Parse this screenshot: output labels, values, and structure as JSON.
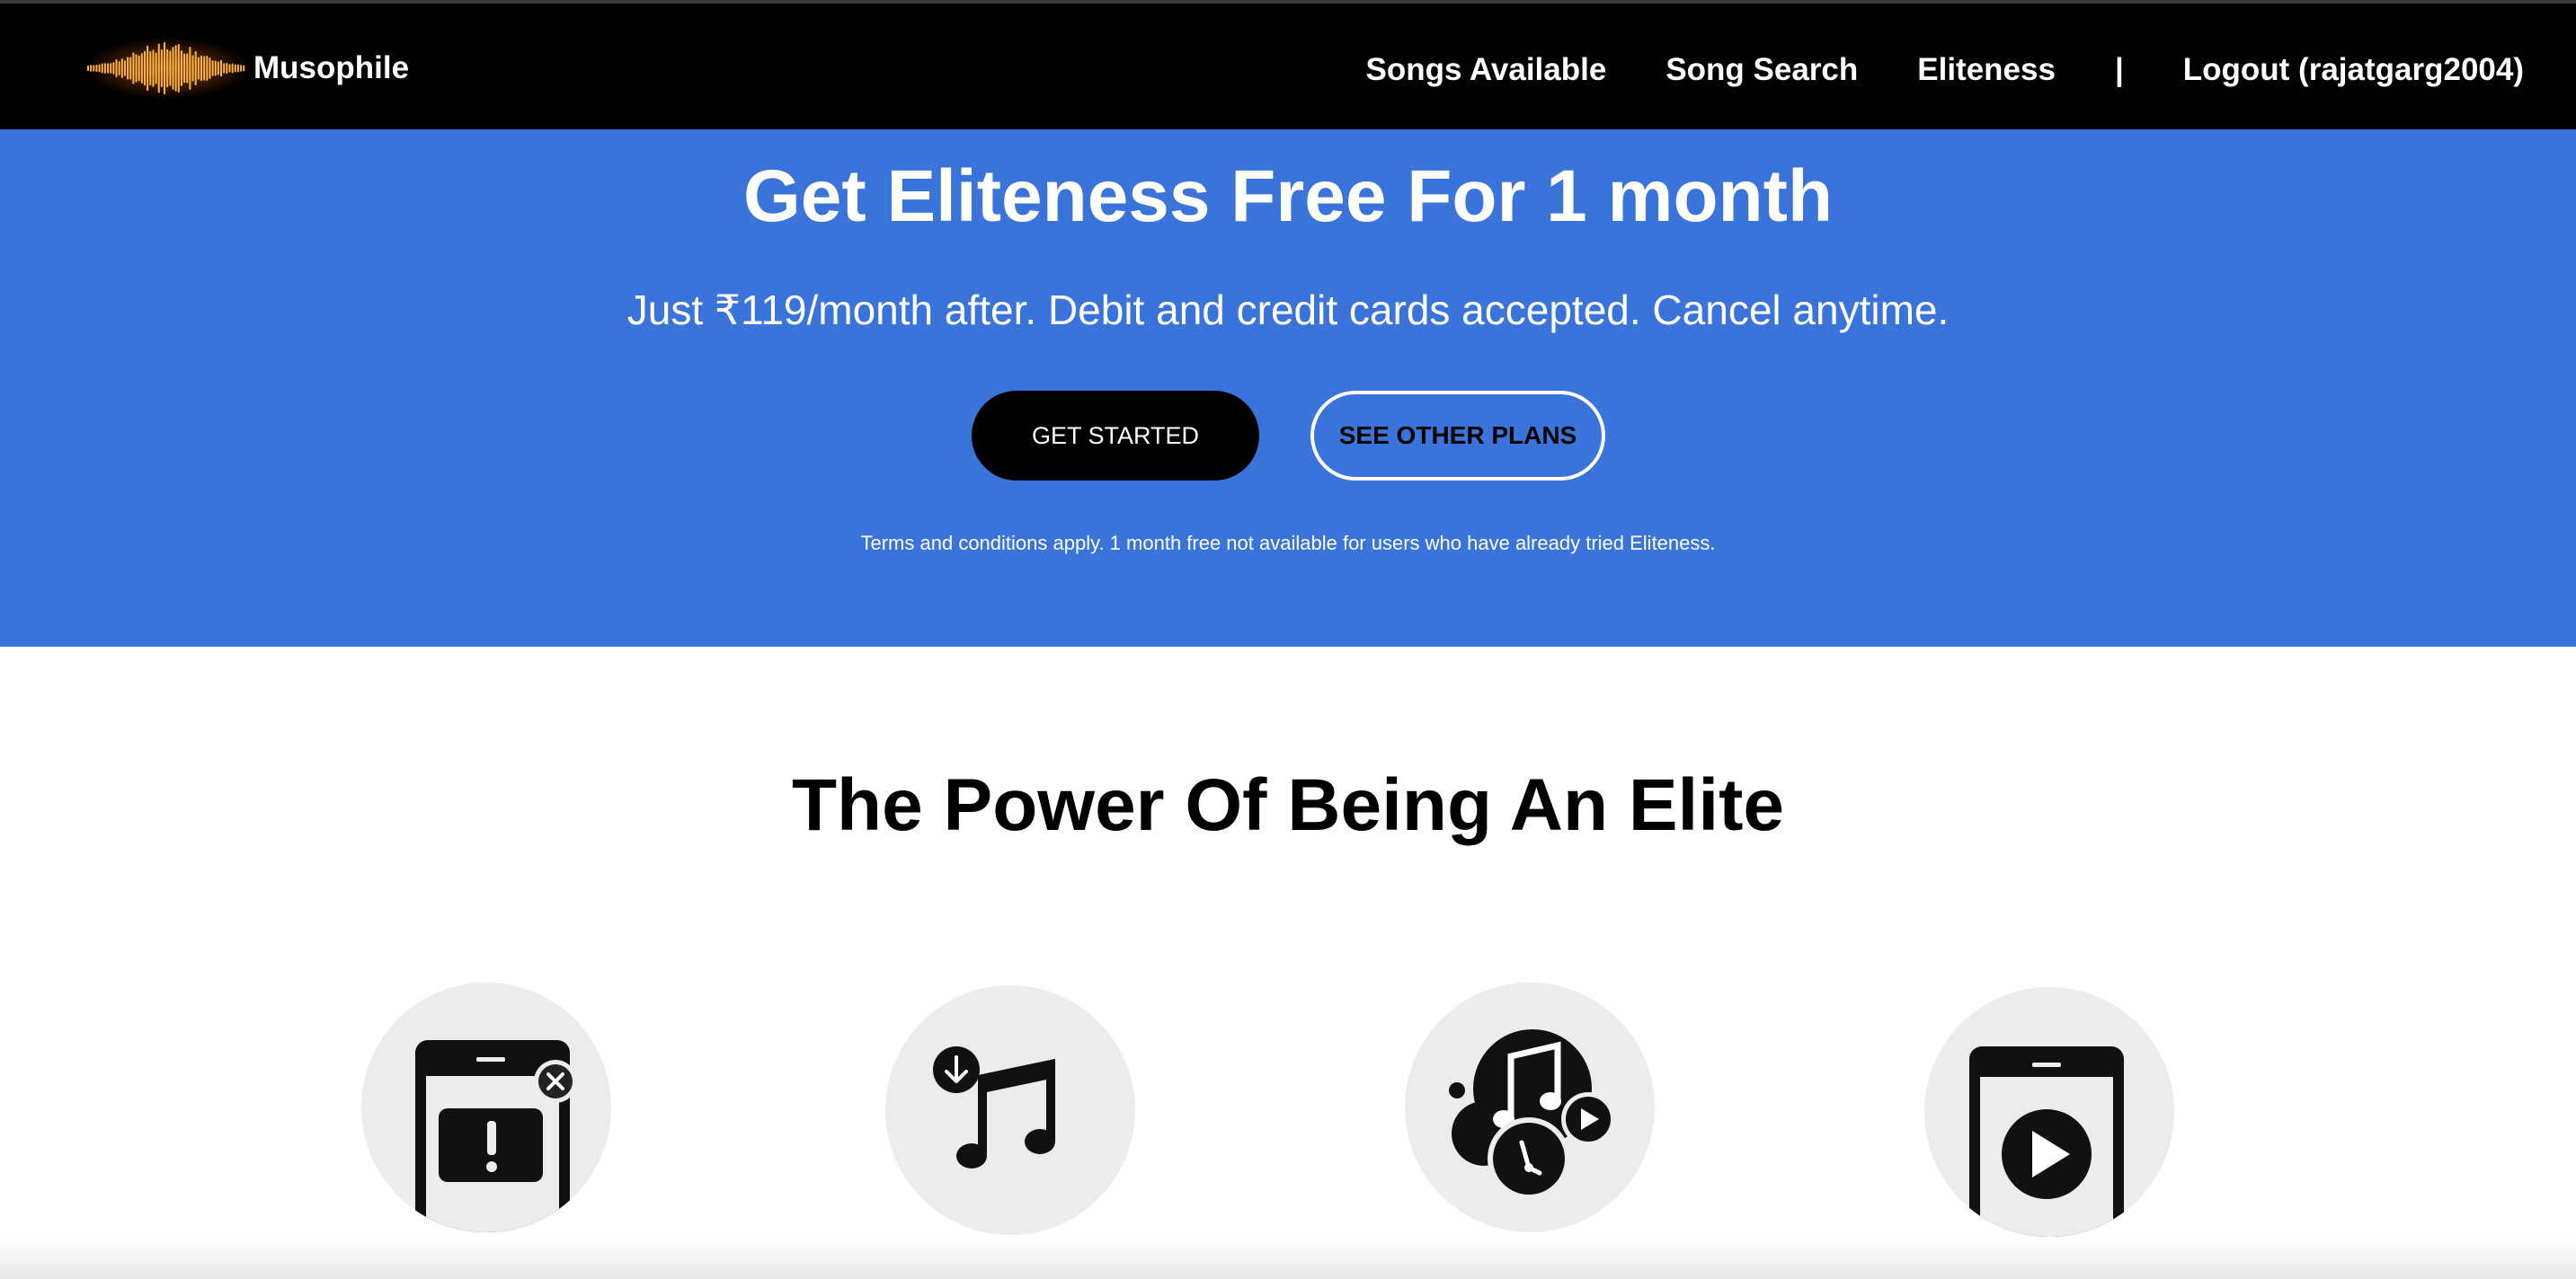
{
  "app": {
    "name": "Musophile"
  },
  "nav": {
    "links": [
      {
        "label": "Songs Available"
      },
      {
        "label": "Song Search"
      },
      {
        "label": "Eliteness"
      }
    ],
    "separator": "|",
    "logout_label": "Logout (rajatgarg2004)"
  },
  "hero": {
    "title": "Get Eliteness Free For 1 month",
    "subtitle": "Just ₹119/month after. Debit and credit cards accepted. Cancel anytime.",
    "primary_button": "GET STARTED",
    "secondary_button": "SEE OTHER PLANS",
    "terms": "Terms and conditions apply. 1 month free not available for users who have already tried Eliteness.",
    "background_color": "#3a73d9"
  },
  "features": {
    "title": "The Power Of Being An Elite",
    "items": [
      {
        "icon": "no-ads-phone-icon"
      },
      {
        "icon": "download-music-icon"
      },
      {
        "icon": "play-any-song-icon"
      },
      {
        "icon": "phone-play-icon"
      }
    ]
  },
  "colors": {
    "navbar": "#000000",
    "accent": "#3a73d9",
    "icon_circle": "#ececec"
  }
}
